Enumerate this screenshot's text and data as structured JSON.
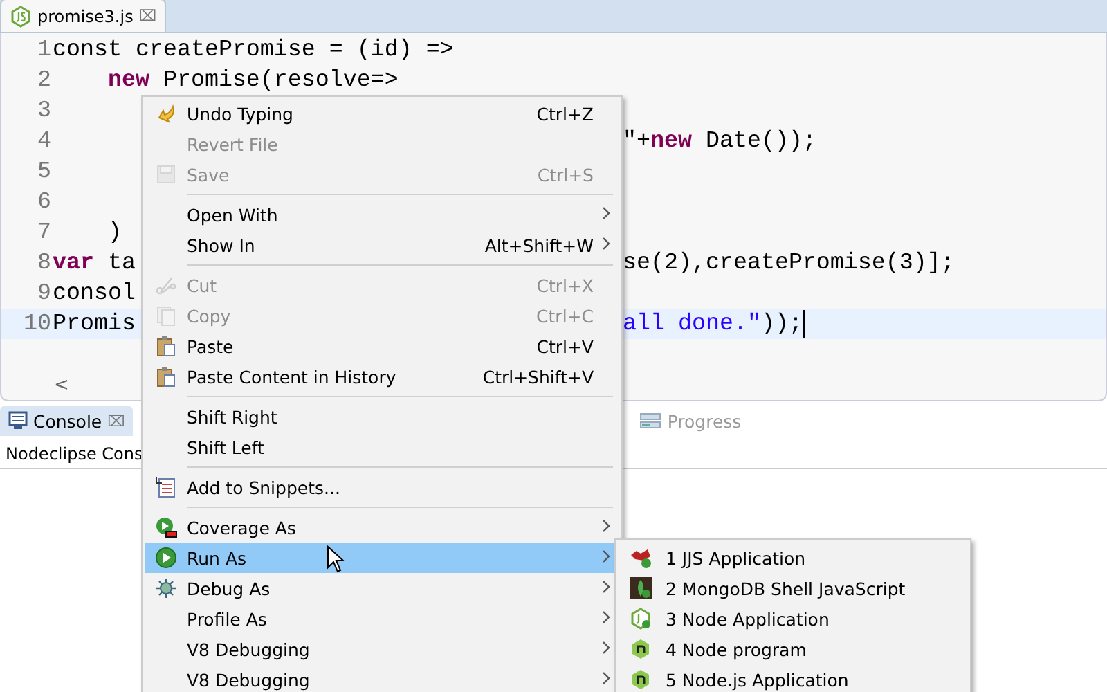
{
  "editor": {
    "tab": {
      "label": "promise3.js",
      "close": "⌧",
      "selected": true
    },
    "lines": [
      {
        "number": "1",
        "left": [
          {
            "kind": "plain",
            "text": "const createPromise = (id) =>"
          }
        ],
        "current": false
      },
      {
        "number": "2",
        "left": [
          {
            "kind": "keyword",
            "text": "    new"
          },
          {
            "kind": "plain",
            "text": " Promise(resolve=>"
          }
        ],
        "current": false
      },
      {
        "number": "3",
        "current": false
      },
      {
        "number": "4",
        "right": [
          {
            "kind": "plain",
            "text": "\"+"
          },
          {
            "kind": "keyword",
            "text": "new"
          },
          {
            "kind": "plain",
            "text": " Date());"
          }
        ],
        "current": false
      },
      {
        "number": "5",
        "current": false
      },
      {
        "number": "6",
        "current": false
      },
      {
        "number": "7",
        "left": [
          {
            "kind": "plain",
            "text": "    )"
          }
        ],
        "current": false
      },
      {
        "number": "8",
        "left": [
          {
            "kind": "keyword",
            "text": "var"
          },
          {
            "kind": "plain",
            "text": " ta"
          }
        ],
        "right": [
          {
            "kind": "plain",
            "text": "se(2),createPromise(3)];"
          }
        ],
        "current": false
      },
      {
        "number": "9",
        "left": [
          {
            "kind": "plain",
            "text": "consol"
          }
        ],
        "current": false
      },
      {
        "number": "10",
        "left": [
          {
            "kind": "plain",
            "text": "Promis"
          }
        ],
        "right": [
          {
            "kind": "string",
            "text": "all done.\""
          },
          {
            "kind": "plain",
            "text": "));"
          }
        ],
        "current": true
      }
    ],
    "scroll_left": "<"
  },
  "panel": {
    "tabs": [
      {
        "label": "Console",
        "close": "⌧",
        "selected": true
      },
      {
        "label": "Progress",
        "selected": false
      }
    ],
    "console_title": "Nodeclipse Cons"
  },
  "context_menu": [
    {
      "kind": "item",
      "label": "Undo Typing",
      "shortcut": "Ctrl+Z",
      "submenu": false,
      "disabled": false,
      "selected": false
    },
    {
      "kind": "item",
      "label": "Revert File",
      "submenu": false,
      "disabled": true,
      "selected": false
    },
    {
      "kind": "item",
      "label": "Save",
      "shortcut": "Ctrl+S",
      "submenu": false,
      "disabled": true,
      "selected": false
    },
    {
      "kind": "separator"
    },
    {
      "kind": "item",
      "label": "Open With",
      "submenu": true,
      "disabled": false,
      "selected": false
    },
    {
      "kind": "item",
      "label": "Show In",
      "shortcut": "Alt+Shift+W",
      "submenu": true,
      "disabled": false,
      "selected": false
    },
    {
      "kind": "separator"
    },
    {
      "kind": "item",
      "label": "Cut",
      "shortcut": "Ctrl+X",
      "submenu": false,
      "disabled": true,
      "selected": false
    },
    {
      "kind": "item",
      "label": "Copy",
      "shortcut": "Ctrl+C",
      "submenu": false,
      "disabled": true,
      "selected": false
    },
    {
      "kind": "item",
      "label": "Paste",
      "shortcut": "Ctrl+V",
      "submenu": false,
      "disabled": false,
      "selected": false
    },
    {
      "kind": "item",
      "label": "Paste Content in History",
      "shortcut": "Ctrl+Shift+V",
      "submenu": false,
      "disabled": false,
      "selected": false
    },
    {
      "kind": "separator"
    },
    {
      "kind": "item",
      "label": "Shift Right",
      "submenu": false,
      "disabled": false,
      "selected": false
    },
    {
      "kind": "item",
      "label": "Shift Left",
      "submenu": false,
      "disabled": false,
      "selected": false
    },
    {
      "kind": "separator"
    },
    {
      "kind": "item",
      "label": "Add to Snippets...",
      "submenu": false,
      "disabled": false,
      "selected": false
    },
    {
      "kind": "separator"
    },
    {
      "kind": "item",
      "label": "Coverage As",
      "submenu": true,
      "disabled": false,
      "selected": false
    },
    {
      "kind": "item",
      "label": "Run As",
      "submenu": true,
      "disabled": false,
      "selected": true
    },
    {
      "kind": "item",
      "label": "Debug As",
      "submenu": true,
      "disabled": false,
      "selected": false
    },
    {
      "kind": "item",
      "label": "Profile As",
      "submenu": true,
      "disabled": false,
      "selected": false
    },
    {
      "kind": "item",
      "label": "V8 Debugging",
      "submenu": true,
      "disabled": false,
      "selected": false
    },
    {
      "kind": "item",
      "label": "V8 Debugging",
      "submenu": true,
      "disabled": false,
      "selected": false
    }
  ],
  "submenu": [
    {
      "label": "1 JJS Application"
    },
    {
      "label": "2 MongoDB Shell JavaScript"
    },
    {
      "label": "3 Node Application"
    },
    {
      "label": "4 Node program"
    },
    {
      "label": "5 Node.js Application"
    }
  ]
}
